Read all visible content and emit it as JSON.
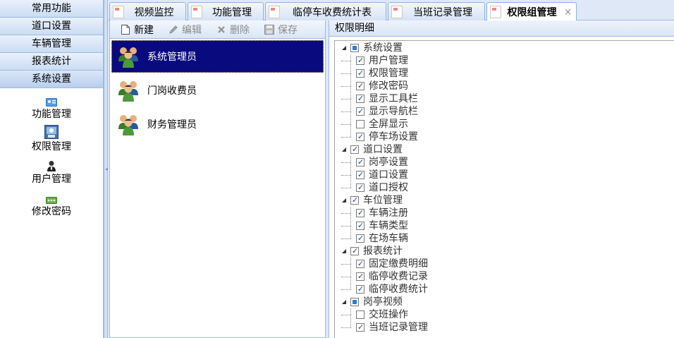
{
  "nav": {
    "headers": [
      {
        "label": "常用功能"
      },
      {
        "label": "道口设置"
      },
      {
        "label": "车辆管理"
      },
      {
        "label": "报表统计"
      },
      {
        "label": "系统设置"
      }
    ],
    "items": [
      {
        "label": "功能管理",
        "icon": "id-card-icon"
      },
      {
        "label": "权限管理",
        "icon": "permission-icon"
      },
      {
        "label": "用户管理",
        "icon": "user-icon"
      },
      {
        "label": "修改密码",
        "icon": "password-icon"
      }
    ]
  },
  "tabs": [
    {
      "label": "视频监控"
    },
    {
      "label": "功能管理"
    },
    {
      "label": "临停车收费统计表"
    },
    {
      "label": "当班记录管理"
    },
    {
      "label": "权限组管理",
      "active": true,
      "close": "×"
    }
  ],
  "toolbar": {
    "new_label": "新建",
    "edit_label": "编辑",
    "delete_label": "删除",
    "save_label": "保存"
  },
  "roles": [
    {
      "label": "系统管理员",
      "selected": true
    },
    {
      "label": "门岗收费员"
    },
    {
      "label": "财务管理员"
    }
  ],
  "permissions": {
    "header": "权限明细",
    "groups": [
      {
        "label": "系统设置",
        "state": "partial",
        "children": [
          {
            "label": "用户管理",
            "checked": true
          },
          {
            "label": "权限管理",
            "checked": true
          },
          {
            "label": "修改密码",
            "checked": true
          },
          {
            "label": "显示工具栏",
            "checked": true
          },
          {
            "label": "显示导航栏",
            "checked": true
          },
          {
            "label": "全屏显示",
            "checked": false
          },
          {
            "label": "停车场设置",
            "checked": true
          }
        ]
      },
      {
        "label": "道口设置",
        "state": "checked",
        "children": [
          {
            "label": "岗亭设置",
            "checked": true
          },
          {
            "label": "道口设置",
            "checked": true
          },
          {
            "label": "道口授权",
            "checked": true
          }
        ]
      },
      {
        "label": "车位管理",
        "state": "checked",
        "children": [
          {
            "label": "车辆注册",
            "checked": true
          },
          {
            "label": "车辆类型",
            "checked": true
          },
          {
            "label": "在场车辆",
            "checked": true
          }
        ]
      },
      {
        "label": "报表统计",
        "state": "checked",
        "children": [
          {
            "label": "固定缴费明细",
            "checked": true
          },
          {
            "label": "临停收费记录",
            "checked": true
          },
          {
            "label": "临停收费统计",
            "checked": true
          }
        ]
      },
      {
        "label": "岗亭视频",
        "state": "partial",
        "children": [
          {
            "label": "交班操作",
            "checked": false
          },
          {
            "label": "当班记录管理",
            "checked": true
          }
        ]
      }
    ]
  }
}
